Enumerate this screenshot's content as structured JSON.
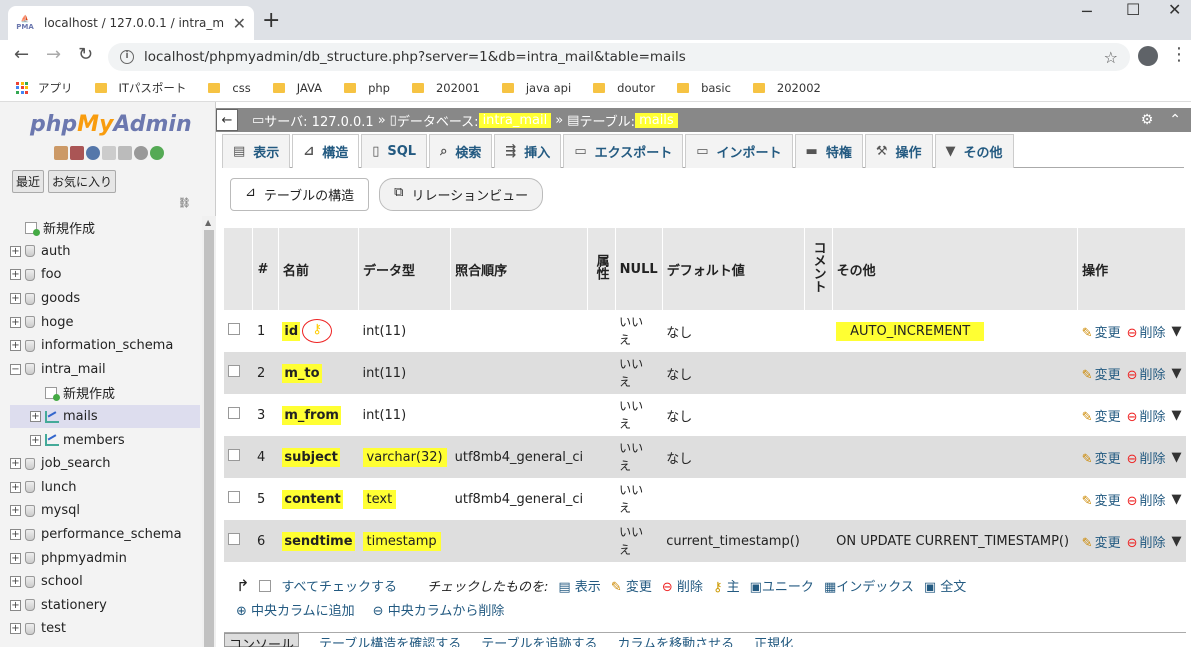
{
  "browser": {
    "tab_title": "localhost / 127.0.0.1 / intra_mail /",
    "url": "localhost/phpmyadmin/db_structure.php?server=1&db=intra_mail&table=mails",
    "bookmarks": [
      "アプリ",
      "ITパスポート",
      "css",
      "JAVA",
      "php",
      "202001",
      "java api",
      "doutor",
      "basic",
      "202002"
    ]
  },
  "nav": {
    "logo_php": "php",
    "logo_my": "My",
    "logo_admin": "Admin",
    "btn_recent": "最近",
    "btn_favorites": "お気に入り",
    "tree": [
      {
        "label": "新規作成",
        "type": "new",
        "depth": 0
      },
      {
        "label": "auth",
        "type": "db",
        "depth": 0
      },
      {
        "label": "foo",
        "type": "db",
        "depth": 0
      },
      {
        "label": "goods",
        "type": "db",
        "depth": 0
      },
      {
        "label": "hoge",
        "type": "db",
        "depth": 0
      },
      {
        "label": "information_schema",
        "type": "db",
        "depth": 0
      },
      {
        "label": "intra_mail",
        "type": "db-open",
        "depth": 0
      },
      {
        "label": "新規作成",
        "type": "new",
        "depth": 1
      },
      {
        "label": "mails",
        "type": "table",
        "depth": 1,
        "selected": true
      },
      {
        "label": "members",
        "type": "table",
        "depth": 1
      },
      {
        "label": "job_search",
        "type": "db",
        "depth": 0
      },
      {
        "label": "lunch",
        "type": "db",
        "depth": 0
      },
      {
        "label": "mysql",
        "type": "db",
        "depth": 0
      },
      {
        "label": "performance_schema",
        "type": "db",
        "depth": 0
      },
      {
        "label": "phpmyadmin",
        "type": "db",
        "depth": 0
      },
      {
        "label": "school",
        "type": "db",
        "depth": 0
      },
      {
        "label": "stationery",
        "type": "db",
        "depth": 0
      },
      {
        "label": "test",
        "type": "db",
        "depth": 0
      }
    ]
  },
  "breadcrumb": {
    "server_label": "サーバ: 127.0.0.1",
    "db_label": "データベース: ",
    "db_name": "intra_mail",
    "table_label": "テーブル: ",
    "table_name": "mails"
  },
  "tabs": [
    "表示",
    "構造",
    "SQL",
    "検索",
    "挿入",
    "エクスポート",
    "インポート",
    "特権",
    "操作",
    "その他"
  ],
  "subtabs": {
    "structure": "テーブルの構造",
    "relation": "リレーションビュー"
  },
  "table": {
    "headers": {
      "num": "#",
      "name": "名前",
      "type": "データ型",
      "collation": "照合順序",
      "attributes": "属性",
      "null": "NULL",
      "default": "デフォルト値",
      "comment": "コメント",
      "extra": "その他",
      "action": "操作"
    },
    "rows": [
      {
        "num": "1",
        "name": "id",
        "type": "int(11)",
        "collation": "",
        "null": "いいえ",
        "default": "なし",
        "extra": "AUTO_INCREMENT"
      },
      {
        "num": "2",
        "name": "m_to",
        "type": "int(11)",
        "collation": "",
        "null": "いいえ",
        "default": "なし",
        "extra": ""
      },
      {
        "num": "3",
        "name": "m_from",
        "type": "int(11)",
        "collation": "",
        "null": "いいえ",
        "default": "なし",
        "extra": ""
      },
      {
        "num": "4",
        "name": "subject",
        "type": "varchar(32)",
        "collation": "utf8mb4_general_ci",
        "null": "いいえ",
        "default": "なし",
        "extra": ""
      },
      {
        "num": "5",
        "name": "content",
        "type": "text",
        "collation": "utf8mb4_general_ci",
        "null": "いいえ",
        "default": "",
        "extra": ""
      },
      {
        "num": "6",
        "name": "sendtime",
        "type": "timestamp",
        "collation": "",
        "null": "いいえ",
        "default": "current_timestamp()",
        "extra": "ON UPDATE CURRENT_TIMESTAMP()"
      }
    ],
    "edit_label": "変更",
    "delete_label": "削除"
  },
  "bulk": {
    "check_all": "すべてチェックする",
    "with_selected": "チェックしたものを:",
    "actions": [
      "表示",
      "変更",
      "削除",
      "主",
      "ユニーク",
      "インデックス",
      "全文"
    ],
    "central_add": "中央カラムに追加",
    "central_remove": "中央カラムから削除"
  },
  "console": {
    "label": "コンソール",
    "links": [
      "テーブル構造を確認する",
      "テーブルを追跡する",
      "カラムを移動させる",
      "正規化"
    ]
  }
}
